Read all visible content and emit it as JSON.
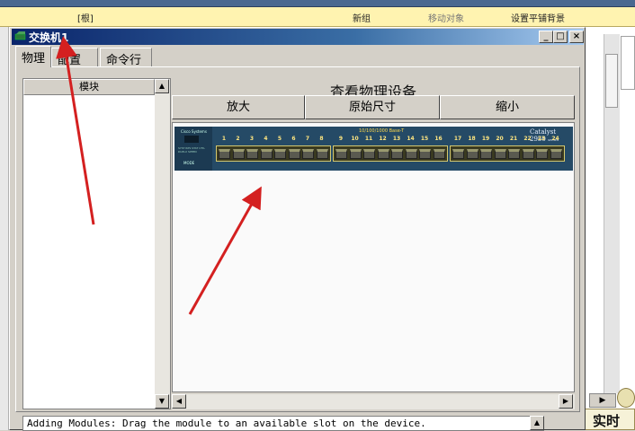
{
  "background_app": {
    "toolbar": {
      "root_label": "[根]",
      "new_group": "新组",
      "move_object": "移动对象",
      "set_tiled_background": "设置平铺背景"
    },
    "realtime_label": "实时"
  },
  "window": {
    "title": "交换机1",
    "controls": {
      "minimize": "_",
      "maximize": "□",
      "close": "×"
    },
    "tabs": [
      {
        "label": "物理",
        "active": true
      },
      {
        "label": "配置",
        "active": false
      },
      {
        "label": "命令行",
        "active": false
      }
    ],
    "module_panel": {
      "header": "模块"
    },
    "device_view": {
      "title": "查看物理设备",
      "zoom_in": "放大",
      "original_size": "原始尺寸",
      "zoom_out": "缩小"
    },
    "switch": {
      "brand": "Cisco Systems",
      "port_title": "10/100/1000 Base-T",
      "model": "Catalyst 2950",
      "model_suffix": "SERIES",
      "mode_label": "MODE",
      "led_labels": "SYST RPS STAT UTIL DUPLX SPEED",
      "ports": [
        "1",
        "2",
        "3",
        "4",
        "5",
        "6",
        "7",
        "8",
        "9",
        "10",
        "11",
        "12",
        "13",
        "14",
        "15",
        "16",
        "17",
        "18",
        "19",
        "20",
        "21",
        "22",
        "23",
        "24"
      ]
    },
    "status_text": "Adding Modules: Drag the module to an available slot on the device."
  },
  "annotation_color": "#d42020"
}
